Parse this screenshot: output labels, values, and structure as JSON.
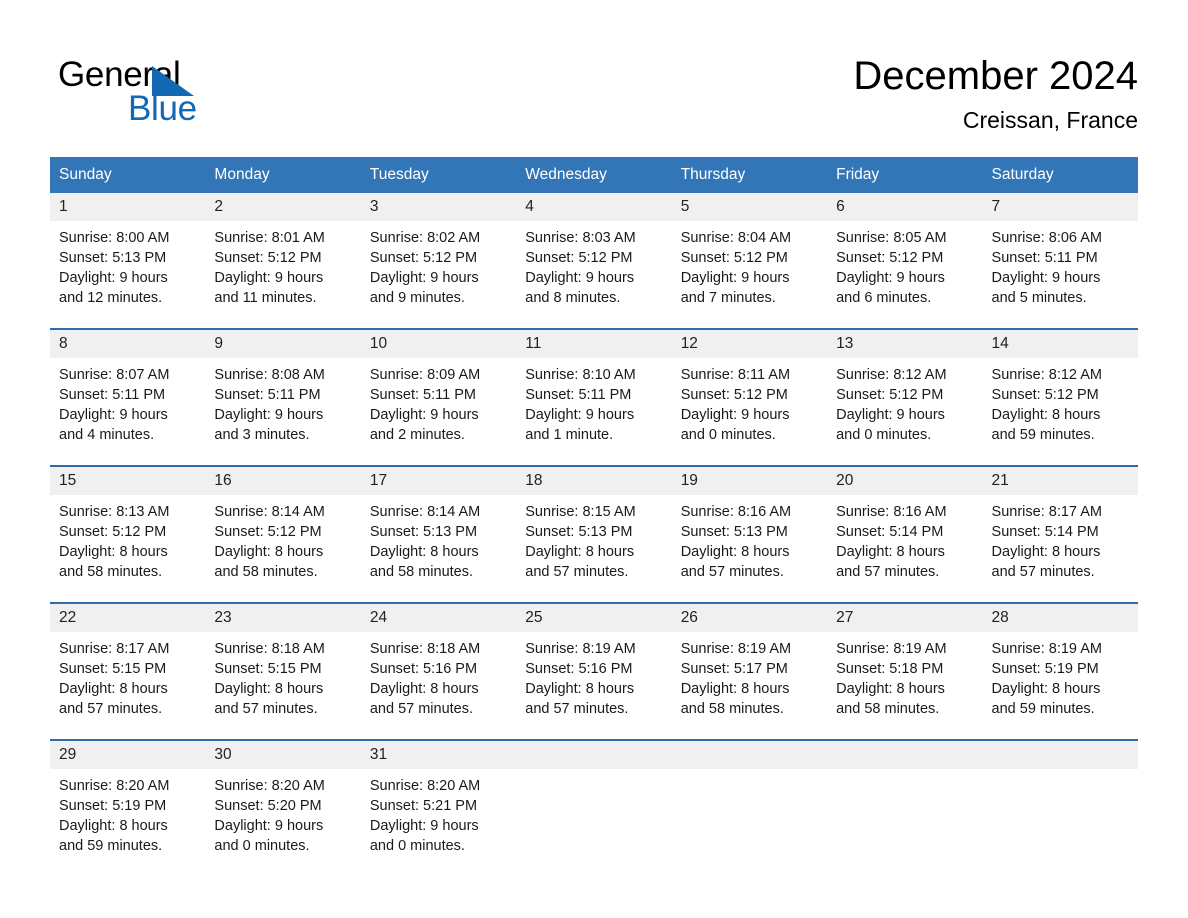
{
  "brand": {
    "name_part1": "General",
    "name_part2": "Blue",
    "triangle_color": "#1268b3"
  },
  "header": {
    "title": "December 2024",
    "subtitle": "Creissan, France"
  },
  "calendar": {
    "header_bg": "#3376b8",
    "daynum_bg": "#f0f0f0",
    "separator_color": "#2e6da8",
    "weekdays": [
      "Sunday",
      "Monday",
      "Tuesday",
      "Wednesday",
      "Thursday",
      "Friday",
      "Saturday"
    ],
    "weeks": [
      [
        {
          "day": "1",
          "sunrise": "Sunrise: 8:00 AM",
          "sunset": "Sunset: 5:13 PM",
          "daylight1": "Daylight: 9 hours",
          "daylight2": "and 12 minutes."
        },
        {
          "day": "2",
          "sunrise": "Sunrise: 8:01 AM",
          "sunset": "Sunset: 5:12 PM",
          "daylight1": "Daylight: 9 hours",
          "daylight2": "and 11 minutes."
        },
        {
          "day": "3",
          "sunrise": "Sunrise: 8:02 AM",
          "sunset": "Sunset: 5:12 PM",
          "daylight1": "Daylight: 9 hours",
          "daylight2": "and 9 minutes."
        },
        {
          "day": "4",
          "sunrise": "Sunrise: 8:03 AM",
          "sunset": "Sunset: 5:12 PM",
          "daylight1": "Daylight: 9 hours",
          "daylight2": "and 8 minutes."
        },
        {
          "day": "5",
          "sunrise": "Sunrise: 8:04 AM",
          "sunset": "Sunset: 5:12 PM",
          "daylight1": "Daylight: 9 hours",
          "daylight2": "and 7 minutes."
        },
        {
          "day": "6",
          "sunrise": "Sunrise: 8:05 AM",
          "sunset": "Sunset: 5:12 PM",
          "daylight1": "Daylight: 9 hours",
          "daylight2": "and 6 minutes."
        },
        {
          "day": "7",
          "sunrise": "Sunrise: 8:06 AM",
          "sunset": "Sunset: 5:11 PM",
          "daylight1": "Daylight: 9 hours",
          "daylight2": "and 5 minutes."
        }
      ],
      [
        {
          "day": "8",
          "sunrise": "Sunrise: 8:07 AM",
          "sunset": "Sunset: 5:11 PM",
          "daylight1": "Daylight: 9 hours",
          "daylight2": "and 4 minutes."
        },
        {
          "day": "9",
          "sunrise": "Sunrise: 8:08 AM",
          "sunset": "Sunset: 5:11 PM",
          "daylight1": "Daylight: 9 hours",
          "daylight2": "and 3 minutes."
        },
        {
          "day": "10",
          "sunrise": "Sunrise: 8:09 AM",
          "sunset": "Sunset: 5:11 PM",
          "daylight1": "Daylight: 9 hours",
          "daylight2": "and 2 minutes."
        },
        {
          "day": "11",
          "sunrise": "Sunrise: 8:10 AM",
          "sunset": "Sunset: 5:11 PM",
          "daylight1": "Daylight: 9 hours",
          "daylight2": "and 1 minute."
        },
        {
          "day": "12",
          "sunrise": "Sunrise: 8:11 AM",
          "sunset": "Sunset: 5:12 PM",
          "daylight1": "Daylight: 9 hours",
          "daylight2": "and 0 minutes."
        },
        {
          "day": "13",
          "sunrise": "Sunrise: 8:12 AM",
          "sunset": "Sunset: 5:12 PM",
          "daylight1": "Daylight: 9 hours",
          "daylight2": "and 0 minutes."
        },
        {
          "day": "14",
          "sunrise": "Sunrise: 8:12 AM",
          "sunset": "Sunset: 5:12 PM",
          "daylight1": "Daylight: 8 hours",
          "daylight2": "and 59 minutes."
        }
      ],
      [
        {
          "day": "15",
          "sunrise": "Sunrise: 8:13 AM",
          "sunset": "Sunset: 5:12 PM",
          "daylight1": "Daylight: 8 hours",
          "daylight2": "and 58 minutes."
        },
        {
          "day": "16",
          "sunrise": "Sunrise: 8:14 AM",
          "sunset": "Sunset: 5:12 PM",
          "daylight1": "Daylight: 8 hours",
          "daylight2": "and 58 minutes."
        },
        {
          "day": "17",
          "sunrise": "Sunrise: 8:14 AM",
          "sunset": "Sunset: 5:13 PM",
          "daylight1": "Daylight: 8 hours",
          "daylight2": "and 58 minutes."
        },
        {
          "day": "18",
          "sunrise": "Sunrise: 8:15 AM",
          "sunset": "Sunset: 5:13 PM",
          "daylight1": "Daylight: 8 hours",
          "daylight2": "and 57 minutes."
        },
        {
          "day": "19",
          "sunrise": "Sunrise: 8:16 AM",
          "sunset": "Sunset: 5:13 PM",
          "daylight1": "Daylight: 8 hours",
          "daylight2": "and 57 minutes."
        },
        {
          "day": "20",
          "sunrise": "Sunrise: 8:16 AM",
          "sunset": "Sunset: 5:14 PM",
          "daylight1": "Daylight: 8 hours",
          "daylight2": "and 57 minutes."
        },
        {
          "day": "21",
          "sunrise": "Sunrise: 8:17 AM",
          "sunset": "Sunset: 5:14 PM",
          "daylight1": "Daylight: 8 hours",
          "daylight2": "and 57 minutes."
        }
      ],
      [
        {
          "day": "22",
          "sunrise": "Sunrise: 8:17 AM",
          "sunset": "Sunset: 5:15 PM",
          "daylight1": "Daylight: 8 hours",
          "daylight2": "and 57 minutes."
        },
        {
          "day": "23",
          "sunrise": "Sunrise: 8:18 AM",
          "sunset": "Sunset: 5:15 PM",
          "daylight1": "Daylight: 8 hours",
          "daylight2": "and 57 minutes."
        },
        {
          "day": "24",
          "sunrise": "Sunrise: 8:18 AM",
          "sunset": "Sunset: 5:16 PM",
          "daylight1": "Daylight: 8 hours",
          "daylight2": "and 57 minutes."
        },
        {
          "day": "25",
          "sunrise": "Sunrise: 8:19 AM",
          "sunset": "Sunset: 5:16 PM",
          "daylight1": "Daylight: 8 hours",
          "daylight2": "and 57 minutes."
        },
        {
          "day": "26",
          "sunrise": "Sunrise: 8:19 AM",
          "sunset": "Sunset: 5:17 PM",
          "daylight1": "Daylight: 8 hours",
          "daylight2": "and 58 minutes."
        },
        {
          "day": "27",
          "sunrise": "Sunrise: 8:19 AM",
          "sunset": "Sunset: 5:18 PM",
          "daylight1": "Daylight: 8 hours",
          "daylight2": "and 58 minutes."
        },
        {
          "day": "28",
          "sunrise": "Sunrise: 8:19 AM",
          "sunset": "Sunset: 5:19 PM",
          "daylight1": "Daylight: 8 hours",
          "daylight2": "and 59 minutes."
        }
      ],
      [
        {
          "day": "29",
          "sunrise": "Sunrise: 8:20 AM",
          "sunset": "Sunset: 5:19 PM",
          "daylight1": "Daylight: 8 hours",
          "daylight2": "and 59 minutes."
        },
        {
          "day": "30",
          "sunrise": "Sunrise: 8:20 AM",
          "sunset": "Sunset: 5:20 PM",
          "daylight1": "Daylight: 9 hours",
          "daylight2": "and 0 minutes."
        },
        {
          "day": "31",
          "sunrise": "Sunrise: 8:20 AM",
          "sunset": "Sunset: 5:21 PM",
          "daylight1": "Daylight: 9 hours",
          "daylight2": "and 0 minutes."
        },
        {
          "day": "",
          "sunrise": "",
          "sunset": "",
          "daylight1": "",
          "daylight2": ""
        },
        {
          "day": "",
          "sunrise": "",
          "sunset": "",
          "daylight1": "",
          "daylight2": ""
        },
        {
          "day": "",
          "sunrise": "",
          "sunset": "",
          "daylight1": "",
          "daylight2": ""
        },
        {
          "day": "",
          "sunrise": "",
          "sunset": "",
          "daylight1": "",
          "daylight2": ""
        }
      ]
    ]
  }
}
